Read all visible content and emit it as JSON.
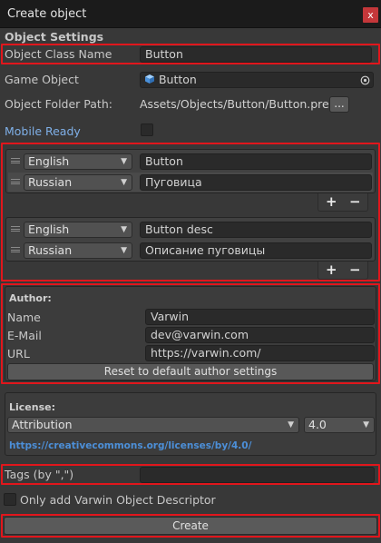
{
  "window": {
    "title": "Create object",
    "close_glyph": "x"
  },
  "section_title": "Object Settings",
  "object_class_name": {
    "label": "Object Class Name",
    "value": "Button"
  },
  "game_object": {
    "label": "Game Object",
    "value": "Button",
    "icon": "cube-icon",
    "picker_icon": "object-picker-icon"
  },
  "folder_path": {
    "label": "Object Folder Path:",
    "value": "Assets/Objects/Button/Button.prefab",
    "browse_label": "..."
  },
  "mobile_ready": {
    "label": "Mobile Ready",
    "checked": false,
    "accent": "#7fb0e8"
  },
  "localization": {
    "name_list": [
      {
        "language": "English",
        "text": "Button"
      },
      {
        "language": "Russian",
        "text": "Пуговица"
      }
    ],
    "desc_list": [
      {
        "language": "English",
        "text": "Button desc"
      },
      {
        "language": "Russian",
        "text": "Описание пуговицы"
      }
    ],
    "add_label": "+",
    "remove_label": "−"
  },
  "author": {
    "header": "Author:",
    "name_label": "Name",
    "name_value": "Varwin",
    "email_label": "E-Mail",
    "email_value": "dev@varwin.com",
    "url_label": "URL",
    "url_value": "https://varwin.com/",
    "reset_label": "Reset to default author settings"
  },
  "license": {
    "header": "License:",
    "type": "Attribution",
    "version": "4.0",
    "link": "https://creativecommons.org/licenses/by/4.0/",
    "link_color": "#4c8fd8"
  },
  "tags": {
    "label": "Tags (by \",\")",
    "value": ""
  },
  "descriptor_only": {
    "label": "Only add Varwin Object Descriptor",
    "checked": false
  },
  "create_label": "Create",
  "colors": {
    "highlight": "#e1161c",
    "background": "#383838",
    "titlebar": "#1b1b1b",
    "close": "#c4373a"
  }
}
